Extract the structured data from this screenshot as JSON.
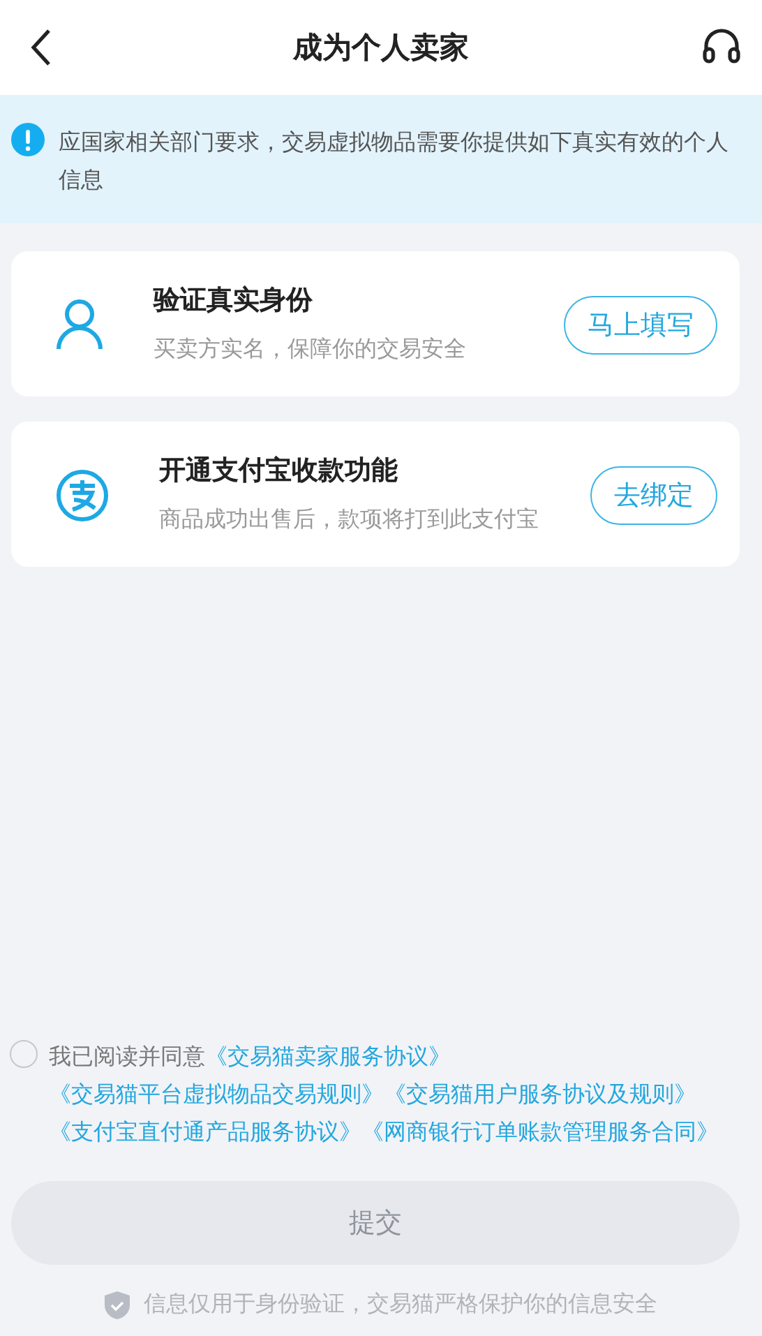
{
  "header": {
    "title": "成为个人卖家"
  },
  "notice": {
    "text": "应国家相关部门要求，交易虚拟物品需要你提供如下真实有效的个人信息"
  },
  "steps": [
    {
      "kind": "identity",
      "title": "验证真实身份",
      "description": "买卖方实名，保障你的交易安全",
      "action": "马上填写"
    },
    {
      "kind": "alipay",
      "title": "开通支付宝收款功能",
      "description": "商品成功出售后，款项将打到此支付宝",
      "action": "去绑定"
    }
  ],
  "agreement": {
    "checked": false,
    "prefix": "我已阅读并同意",
    "links": [
      "《交易猫卖家服务协议》",
      "《交易猫平台虚拟物品交易规则》",
      "《交易猫用户服务协议及规则》",
      "《支付宝直付通产品服务协议》",
      "《网商银行订单账款管理服务合同》"
    ]
  },
  "submit": {
    "label": "提交",
    "disabled": true
  },
  "footer": {
    "text": "信息仅用于身份验证，交易猫严格保护你的信息安全"
  }
}
